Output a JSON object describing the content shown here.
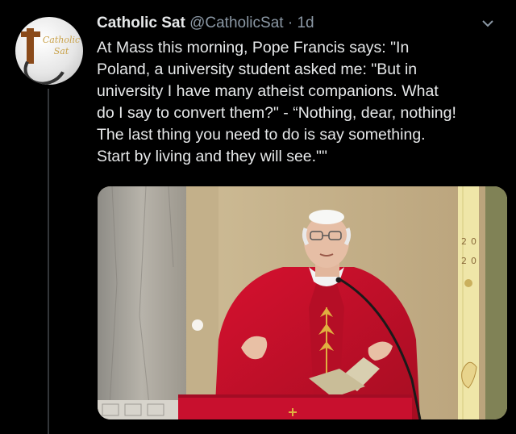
{
  "tweet": {
    "author_name": "Catholic Sat",
    "handle": "@CatholicSat",
    "separator": "·",
    "time": "1d",
    "text": "At Mass this morning, Pope Francis says: \"In\nPoland, a university student asked me: \"But in\nuniversity I have many atheist companions. What\ndo I say to convert them?\" - “Nothing, dear, nothing!\nThe last thing you need to do is say something.\nStart by living and they will see.\"\"",
    "avatar_logo": "Catholic Sat"
  },
  "media": {
    "candle_numbers": [
      "2",
      "0",
      "2",
      "0"
    ]
  },
  "icons": {
    "more": "chevron-down-icon"
  },
  "colors": {
    "background": "#000000",
    "text": "#e7e9ea",
    "secondary_text": "#8b98a5",
    "vestment_red": "#c8102e"
  }
}
